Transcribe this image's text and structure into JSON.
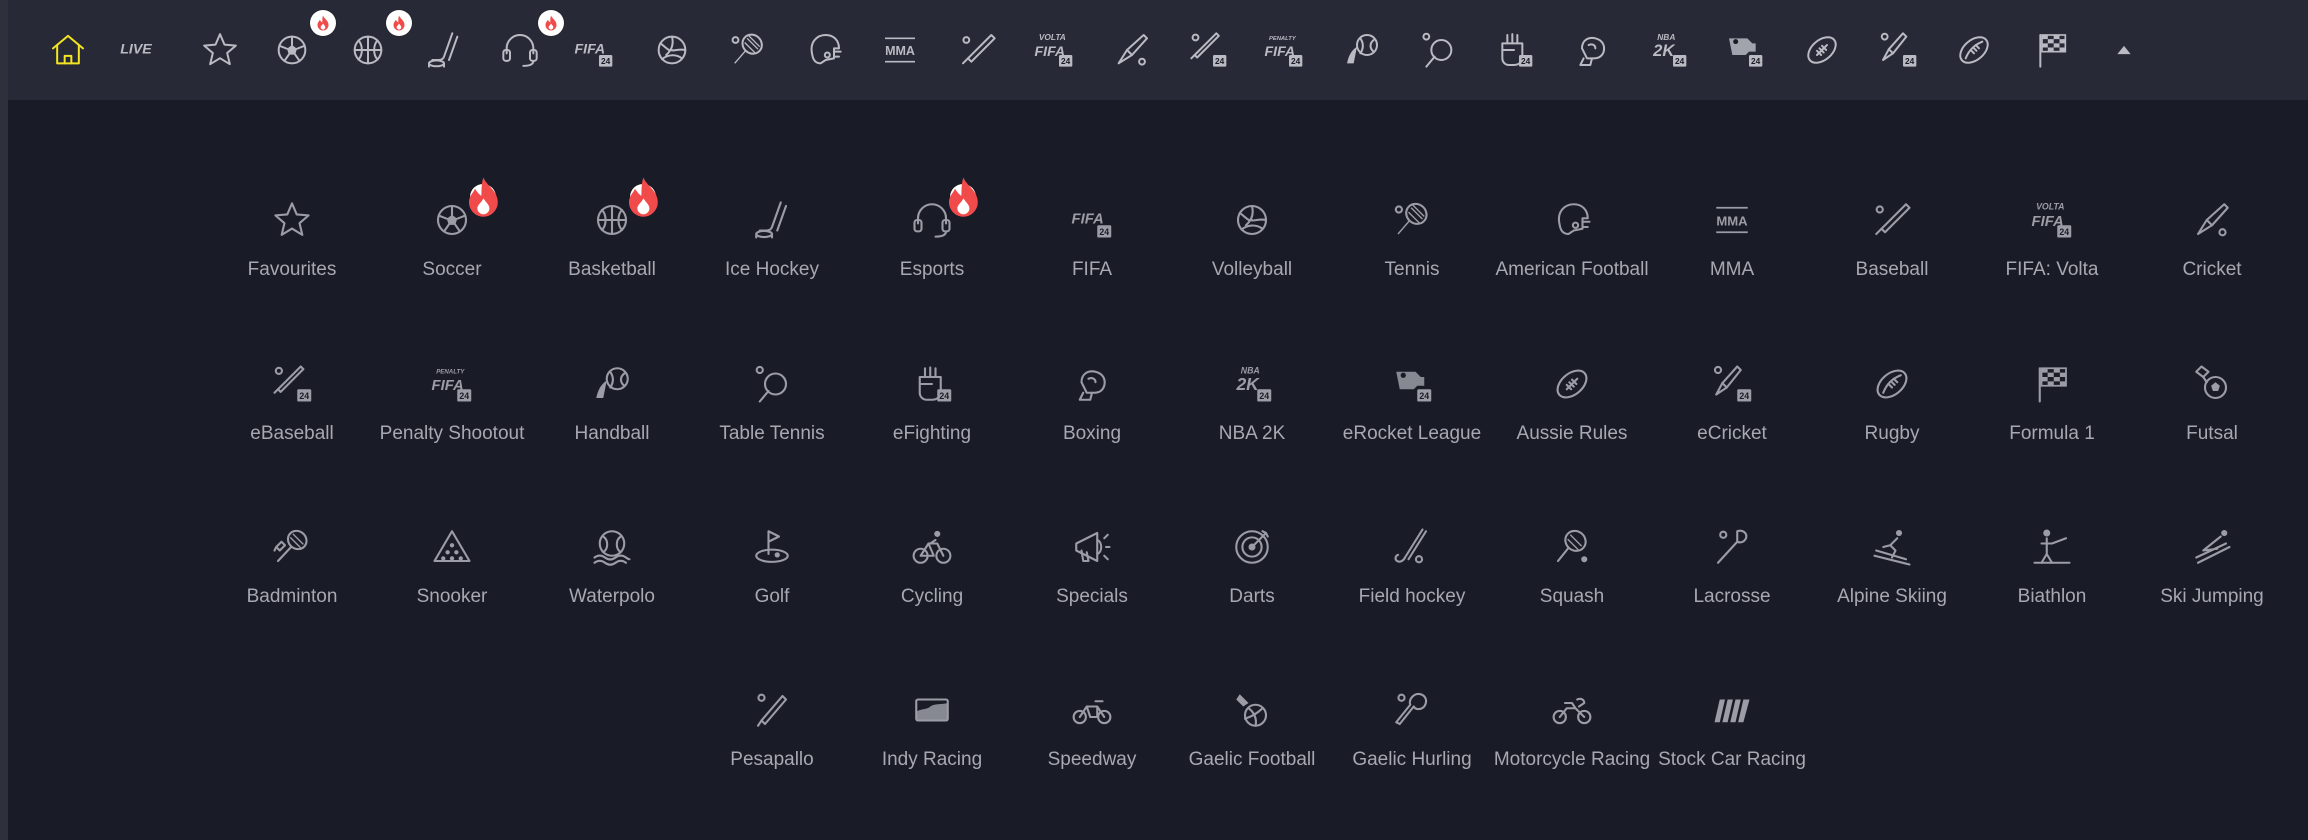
{
  "colors": {
    "background": "#191b26",
    "topbar": "#272936",
    "active": "#f3e523",
    "icon": "#9b9ca6",
    "label": "#a7a8b1",
    "hot_badge": "#f04a4a"
  },
  "topbar": {
    "items": [
      {
        "icon": "home-icon",
        "active": true
      },
      {
        "icon": "live-icon",
        "text": "LIVE"
      },
      {
        "icon": "star-icon"
      },
      {
        "icon": "soccer-icon",
        "hot": true
      },
      {
        "icon": "basketball-icon",
        "hot": true
      },
      {
        "icon": "ice-hockey-icon"
      },
      {
        "icon": "esports-icon",
        "hot": true
      },
      {
        "icon": "fifa-icon",
        "text": "FIFA",
        "sub": "24"
      },
      {
        "icon": "volleyball-icon"
      },
      {
        "icon": "tennis-icon"
      },
      {
        "icon": "american-football-icon"
      },
      {
        "icon": "mma-icon",
        "text": "MMA"
      },
      {
        "icon": "baseball-icon"
      },
      {
        "icon": "fifa-volta-icon",
        "text": "FIFA",
        "top": "VOLTA",
        "sub": "24"
      },
      {
        "icon": "cricket-icon"
      },
      {
        "icon": "ebaseball-icon",
        "sub": "24"
      },
      {
        "icon": "penalty-shootout-icon",
        "text": "FIFA",
        "top": "PENALTY",
        "sub": "24"
      },
      {
        "icon": "handball-icon"
      },
      {
        "icon": "table-tennis-icon"
      },
      {
        "icon": "efighting-icon",
        "sub": "24"
      },
      {
        "icon": "boxing-icon"
      },
      {
        "icon": "nba-2k-icon",
        "text": "2K",
        "top": "NBA",
        "sub": "24"
      },
      {
        "icon": "erocket-league-icon",
        "sub": "24"
      },
      {
        "icon": "aussie-rules-icon"
      },
      {
        "icon": "ecricket-icon",
        "sub": "24"
      },
      {
        "icon": "rugby-icon"
      },
      {
        "icon": "formula-1-icon"
      },
      {
        "icon": "collapse-icon"
      }
    ]
  },
  "sports": [
    {
      "label": "Favourites",
      "icon": "star-icon"
    },
    {
      "label": "Soccer",
      "icon": "soccer-icon",
      "hot": true
    },
    {
      "label": "Basketball",
      "icon": "basketball-icon",
      "hot": true
    },
    {
      "label": "Ice Hockey",
      "icon": "ice-hockey-icon"
    },
    {
      "label": "Esports",
      "icon": "esports-icon",
      "hot": true
    },
    {
      "label": "FIFA",
      "icon": "fifa-icon",
      "text": "FIFA",
      "sub": "24"
    },
    {
      "label": "Volleyball",
      "icon": "volleyball-icon"
    },
    {
      "label": "Tennis",
      "icon": "tennis-icon"
    },
    {
      "label": "American Football",
      "icon": "american-football-icon"
    },
    {
      "label": "MMA",
      "icon": "mma-icon",
      "text": "MMA"
    },
    {
      "label": "Baseball",
      "icon": "baseball-icon"
    },
    {
      "label": "FIFA: Volta",
      "icon": "fifa-volta-icon",
      "text": "FIFA",
      "top": "VOLTA",
      "sub": "24"
    },
    {
      "label": "Cricket",
      "icon": "cricket-icon"
    },
    {
      "label": "eBaseball",
      "icon": "ebaseball-icon",
      "sub": "24"
    },
    {
      "label": "Penalty Shootout",
      "icon": "penalty-shootout-icon",
      "text": "FIFA",
      "top": "PENALTY",
      "sub": "24"
    },
    {
      "label": "Handball",
      "icon": "handball-icon"
    },
    {
      "label": "Table Tennis",
      "icon": "table-tennis-icon"
    },
    {
      "label": "eFighting",
      "icon": "efighting-icon",
      "sub": "24"
    },
    {
      "label": "Boxing",
      "icon": "boxing-icon"
    },
    {
      "label": "NBA 2K",
      "icon": "nba-2k-icon",
      "text": "2K",
      "top": "NBA",
      "sub": "24"
    },
    {
      "label": "eRocket League",
      "icon": "erocket-league-icon",
      "sub": "24"
    },
    {
      "label": "Aussie Rules",
      "icon": "aussie-rules-icon"
    },
    {
      "label": "eCricket",
      "icon": "ecricket-icon",
      "sub": "24"
    },
    {
      "label": "Rugby",
      "icon": "rugby-icon"
    },
    {
      "label": "Formula 1",
      "icon": "formula-1-icon"
    },
    {
      "label": "Futsal",
      "icon": "futsal-icon"
    },
    {
      "label": "Badminton",
      "icon": "badminton-icon"
    },
    {
      "label": "Snooker",
      "icon": "snooker-icon"
    },
    {
      "label": "Waterpolo",
      "icon": "waterpolo-icon"
    },
    {
      "label": "Golf",
      "icon": "golf-icon"
    },
    {
      "label": "Cycling",
      "icon": "cycling-icon"
    },
    {
      "label": "Specials",
      "icon": "specials-icon"
    },
    {
      "label": "Darts",
      "icon": "darts-icon"
    },
    {
      "label": "Field hockey",
      "icon": "field-hockey-icon"
    },
    {
      "label": "Squash",
      "icon": "squash-icon"
    },
    {
      "label": "Lacrosse",
      "icon": "lacrosse-icon"
    },
    {
      "label": "Alpine Skiing",
      "icon": "alpine-skiing-icon"
    },
    {
      "label": "Biathlon",
      "icon": "biathlon-icon"
    },
    {
      "label": "Ski Jumping",
      "icon": "ski-jumping-icon"
    },
    {
      "label": "Pesapallo",
      "icon": "pesapallo-icon"
    },
    {
      "label": "Indy Racing",
      "icon": "indy-racing-icon"
    },
    {
      "label": "Speedway",
      "icon": "speedway-icon"
    },
    {
      "label": "Gaelic Football",
      "icon": "gaelic-football-icon"
    },
    {
      "label": "Gaelic Hurling",
      "icon": "gaelic-hurling-icon"
    },
    {
      "label": "Motorcycle Racing",
      "icon": "motorcycle-racing-icon"
    },
    {
      "label": "Stock Car Racing",
      "icon": "stock-car-racing-icon"
    }
  ]
}
